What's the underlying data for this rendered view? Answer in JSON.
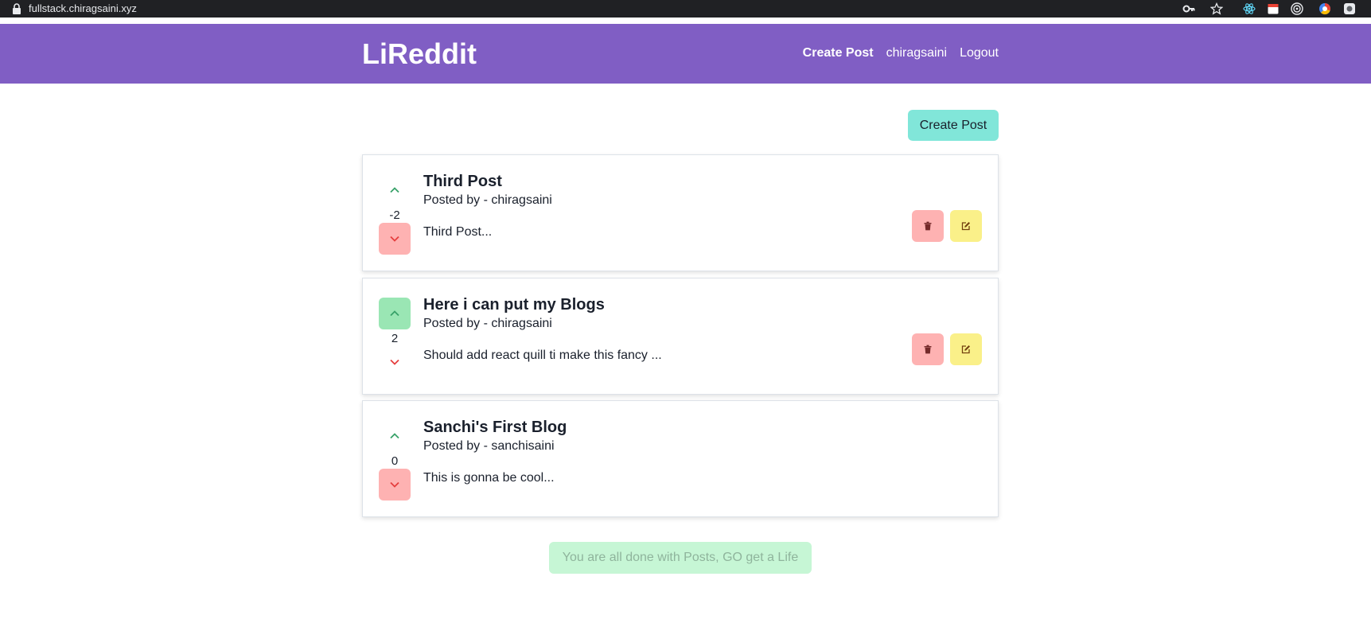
{
  "browser": {
    "url": "fullstack.chiragsaini.xyz"
  },
  "navbar": {
    "brand": "LiReddit",
    "create_post": "Create Post",
    "username": "chiragsaini",
    "logout": "Logout"
  },
  "main": {
    "create_post_button": "Create Post",
    "posts": [
      {
        "title": "Third Post",
        "author": "Posted by - chiragsaini",
        "snippet": "Third Post...",
        "points": "-2",
        "vote": "down",
        "owned": true
      },
      {
        "title": "Here i can put my Blogs",
        "author": "Posted by - chiragsaini",
        "snippet": "Should add react quill ti make this fancy ...",
        "points": "2",
        "vote": "up",
        "owned": true
      },
      {
        "title": "Sanchi's First Blog",
        "author": "Posted by - sanchisaini",
        "snippet": "This is gonna be cool...",
        "points": "0",
        "vote": "down",
        "owned": false
      }
    ],
    "done_message": "You are all done with Posts, GO get a Life"
  },
  "colors": {
    "navbar": "#805ec4",
    "create_button": "#81e6d9",
    "upvote_active": "#9ae6b4",
    "downvote_active": "#feb2b2",
    "delete_button": "#feb2b2",
    "edit_button": "#faf089",
    "done_button": "#c6f6d5"
  },
  "icons": {
    "upvote": "chevron-up-icon",
    "downvote": "chevron-down-icon",
    "delete": "trash-icon",
    "edit": "edit-icon"
  }
}
